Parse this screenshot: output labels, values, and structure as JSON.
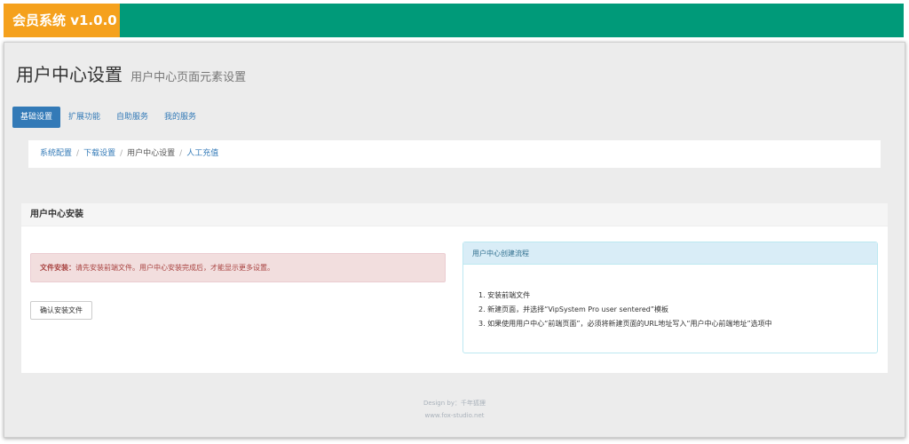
{
  "header": {
    "brand": "会员系统 v1.0.0"
  },
  "page": {
    "title": "用户中心设置",
    "subtitle": "用户中心页面元素设置"
  },
  "tabs": [
    {
      "label": "基础设置",
      "active": true
    },
    {
      "label": "扩展功能",
      "active": false
    },
    {
      "label": "自助服务",
      "active": false
    },
    {
      "label": "我的服务",
      "active": false
    }
  ],
  "breadcrumb": [
    {
      "label": "系统配置",
      "current": false
    },
    {
      "label": "下载设置",
      "current": false
    },
    {
      "label": "用户中心设置",
      "current": true
    },
    {
      "label": "人工充值",
      "current": false
    }
  ],
  "panel": {
    "title": "用户中心安装",
    "alert": {
      "label": "文件安装：",
      "text": "请先安装前端文件。用户中心安装完成后，才能显示更多设置。"
    },
    "button": "确认安装文件",
    "info": {
      "title": "用户中心创建流程",
      "steps": [
        "1. 安装前端文件",
        "2. 新建页面，并选择“VipSystem Pro user sentered”模板",
        "3. 如果使用用户中心“前端页面”，必须将新建页面的URL地址写入“用户中心前端地址”选项中"
      ]
    }
  },
  "footer": {
    "design": "Design by：千年狐狸",
    "site": "www.fox-studio.net"
  },
  "colors": {
    "topbar": "#009a79",
    "brand": "#f5a11d",
    "primary": "#337ab7",
    "alert_bg": "#f2dede",
    "info_bg": "#d9edf7"
  }
}
